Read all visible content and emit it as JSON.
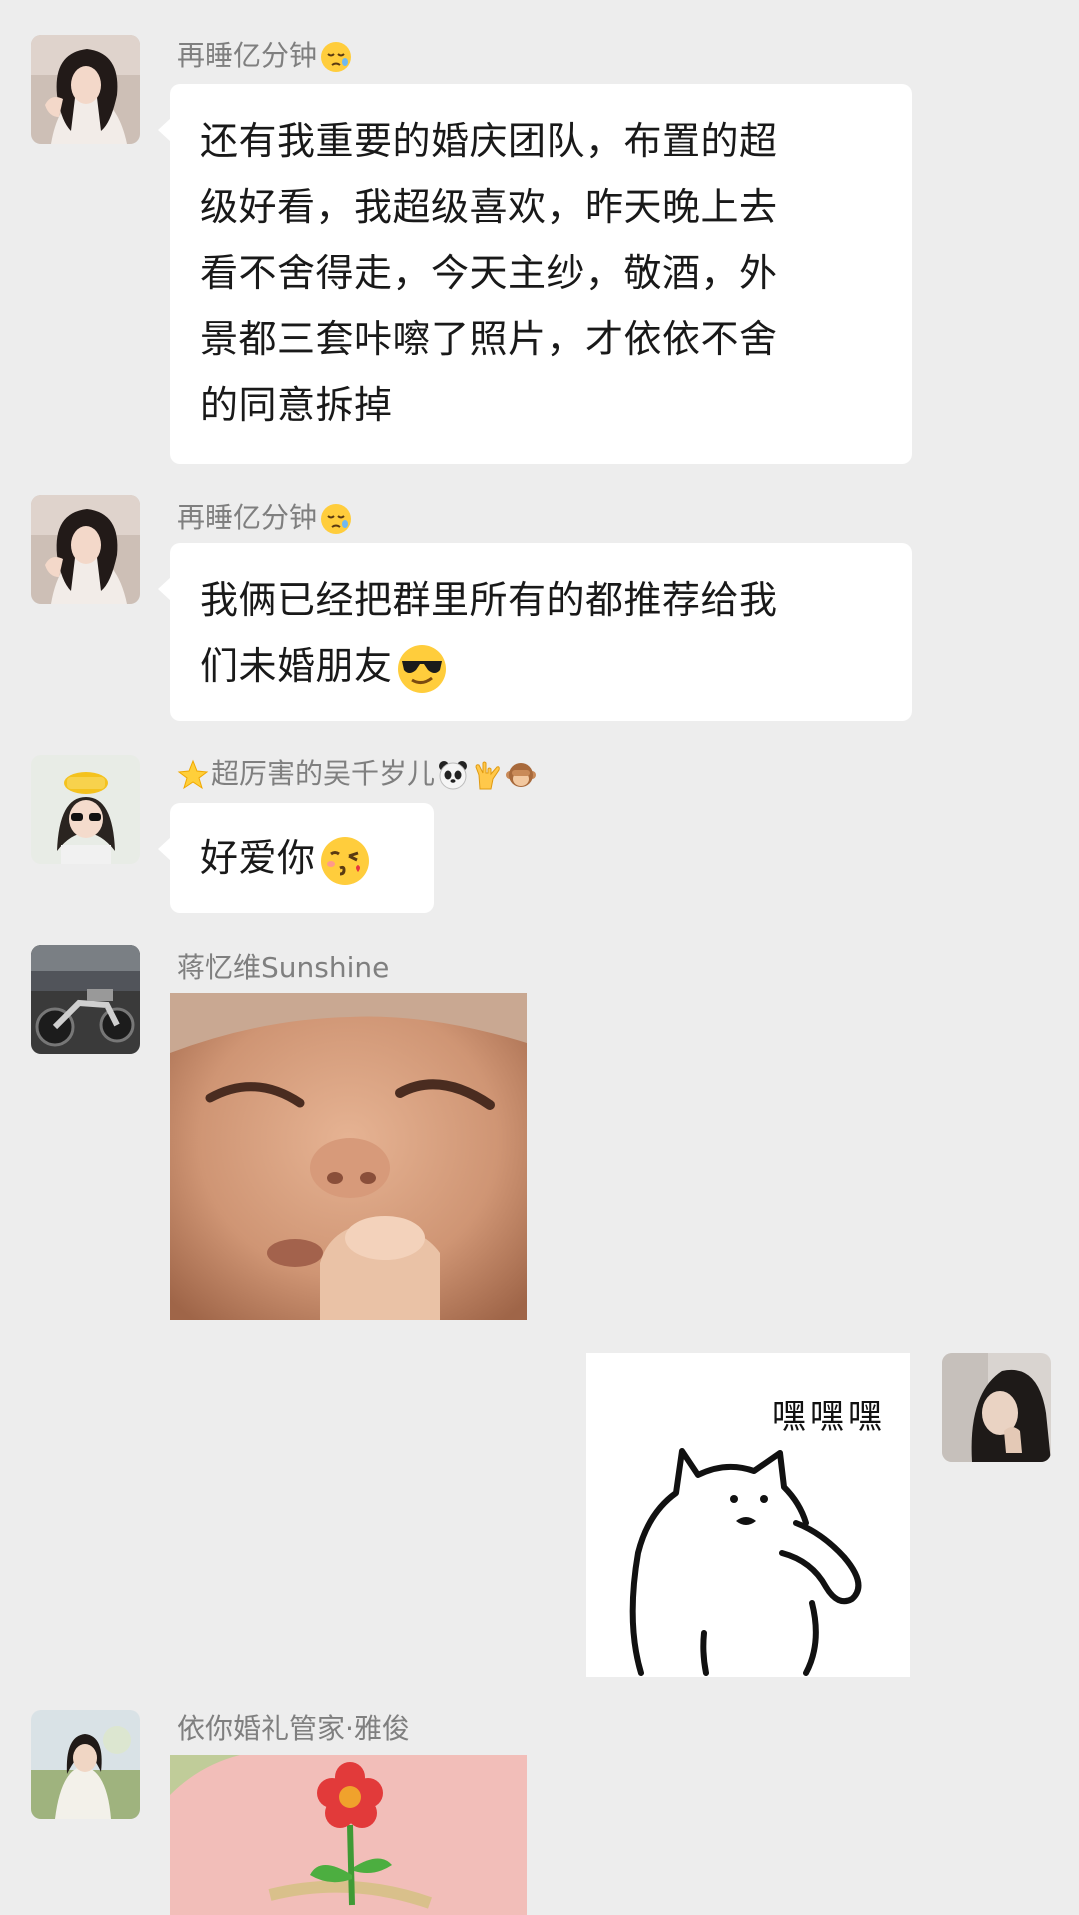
{
  "messages": [
    {
      "sender": "再睡亿分钟",
      "sender_emoji": "sleepy-face",
      "lines": [
        "还有我重要的婚庆团队，布置的超",
        "级好看，我超级喜欢，昨天晚上去",
        "看不舍得走，今天主纱，敬酒，外",
        "景都三套咔嚓了照片，才依依不舍",
        "的同意拆掉"
      ]
    },
    {
      "sender": "再睡亿分钟",
      "sender_emoji": "sleepy-face",
      "lines": [
        "我俩已经把群里所有的都推荐给我",
        "们未婚朋友"
      ],
      "trailing_emoji": "sunglasses-face"
    },
    {
      "sender": "超厉害的吴千岁儿",
      "sender_prefix_emoji": "glowing-star",
      "sender_suffix_emojis": [
        "panda-face",
        "love-you-gesture",
        "see-no-evil-monkey"
      ],
      "lines": [
        "好爱你"
      ],
      "trailing_emoji": "face-blowing-kiss"
    },
    {
      "sender": "蒋忆维Sunshine",
      "image": "baby-face-sticker"
    },
    {
      "self": true,
      "image": "cat-sticker",
      "caption": "嘿嘿嘿"
    },
    {
      "sender": "依你婚礼管家·雅俊",
      "image": "flower-sticker"
    }
  ],
  "colors": {
    "background": "#ededed",
    "bubble": "#ffffff",
    "sender_name": "#7f7f7f",
    "text": "#191919"
  }
}
